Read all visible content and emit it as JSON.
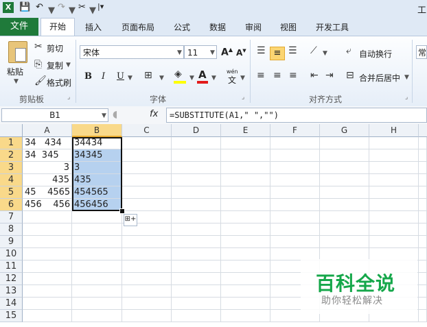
{
  "app": {
    "title_partial": "工"
  },
  "tabs": {
    "file": "文件",
    "home": "开始",
    "insert": "插入",
    "page_layout": "页面布局",
    "formulas": "公式",
    "data": "数据",
    "review": "审阅",
    "view": "视图",
    "developer": "开发工具"
  },
  "clipboard": {
    "paste": "粘贴",
    "cut": "剪切",
    "copy": "复制",
    "format_painter": "格式刷",
    "group": "剪贴板"
  },
  "font": {
    "name": "宋体",
    "size": "11",
    "bold": "B",
    "italic": "I",
    "underline": "U",
    "group": "字体",
    "wen": "wén",
    "wen_char": "文"
  },
  "alignment": {
    "wrap_text": "自动换行",
    "merge_center": "合并后居中",
    "group": "对齐方式"
  },
  "number": {
    "format_partial": "常"
  },
  "formula_bar": {
    "name_box": "B1",
    "fx": "fx",
    "formula": "=SUBSTITUTE(A1,\" \",\"\")"
  },
  "columns": [
    "A",
    "B",
    "C",
    "D",
    "E",
    "F",
    "G",
    "H"
  ],
  "rows": [
    "1",
    "2",
    "3",
    "4",
    "5",
    "6",
    "7",
    "8",
    "9",
    "10",
    "11",
    "12",
    "13",
    "14",
    "15"
  ],
  "cells": {
    "A1": "34   434",
    "B1": "34434",
    "A2": "34  345",
    "B2": "34345",
    "A3": "3",
    "B3": "3",
    "A4": "435",
    "B4": "435",
    "A5": "45    4565",
    "B5": "454565",
    "A6": "456    456",
    "B6": "456456"
  },
  "watermark": {
    "title": "百科全说",
    "subtitle": "助你轻松解决"
  },
  "colors": {
    "file_tab": "#1f7a3a",
    "selection": "#b6d1ef",
    "header_selected": "#f9d98a",
    "watermark": "#15a74a"
  }
}
